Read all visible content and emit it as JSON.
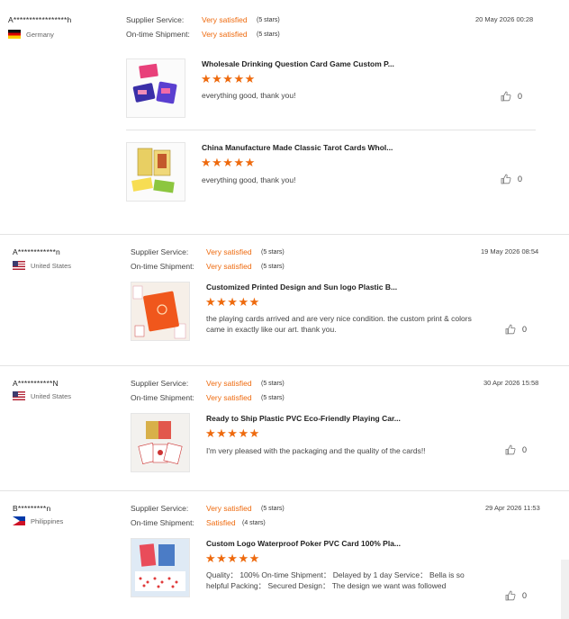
{
  "reviews": [
    {
      "buyer": "A*****************h",
      "country": "Germany",
      "flag": "de",
      "supplier_service_label": "Supplier Service:",
      "supplier_service_value": "Very satisfied",
      "supplier_service_stars": "(5 stars)",
      "shipment_label": "On-time Shipment:",
      "shipment_value": "Very satisfied",
      "shipment_stars": "(5 stars)",
      "date": "20 May 2026 00:28",
      "products": [
        {
          "title": "Wholesale Drinking Question Card Game Custom P...",
          "rating": "★★★★★",
          "comment": "everything good, thank you!",
          "likes": "0"
        },
        {
          "title": "China Manufacture Made Classic Tarot Cards Whol...",
          "rating": "★★★★★",
          "comment": "everything good, thank you!",
          "likes": "0"
        }
      ]
    },
    {
      "buyer": "A************n",
      "country": "United States",
      "flag": "us",
      "supplier_service_label": "Supplier Service:",
      "supplier_service_value": "Very satisfied",
      "supplier_service_stars": "(5 stars)",
      "shipment_label": "On-time Shipment:",
      "shipment_value": "Very satisfied",
      "shipment_stars": "(5 stars)",
      "date": "19 May 2026 08:54",
      "products": [
        {
          "title": "Customized Printed Design and Sun logo Plastic B...",
          "rating": "★★★★★",
          "comment": "the playing cards arrived and are very nice condition. the custom print & colors came in exactly like our art. thank you.",
          "likes": "0"
        }
      ]
    },
    {
      "buyer": "A***********N",
      "country": "United States",
      "flag": "us",
      "supplier_service_label": "Supplier Service:",
      "supplier_service_value": "Very satisfied",
      "supplier_service_stars": "(5 stars)",
      "shipment_label": "On-time Shipment:",
      "shipment_value": "Very satisfied",
      "shipment_stars": "(5 stars)",
      "date": "30 Apr 2026 15:58",
      "products": [
        {
          "title": "Ready to Ship Plastic PVC Eco-Friendly Playing Car...",
          "rating": "★★★★★",
          "comment": "I'm very pleased with the packaging and the quality of the cards!!",
          "likes": "0"
        }
      ]
    },
    {
      "buyer": "B*********n",
      "country": "Philippines",
      "flag": "ph",
      "supplier_service_label": "Supplier Service:",
      "supplier_service_value": "Very satisfied",
      "supplier_service_stars": "(5 stars)",
      "shipment_label": "On-time Shipment:",
      "shipment_value": "Satisfied",
      "shipment_stars": "(4 stars)",
      "date": "29 Apr 2026 11:53",
      "products": [
        {
          "title": "Custom Logo Waterproof Poker PVC Card 100% Pla...",
          "rating": "★★★★★",
          "comment": "Quality： 100% On-time Shipment： Delayed by 1 day Service： Bella is so helpful Packing： Secured Design： The design we want was followed",
          "likes": "0"
        }
      ]
    }
  ],
  "colors": {
    "accent": "#ee6a0e",
    "divider": "#e3e3e3"
  },
  "icons": {
    "like": "thumbs-up-icon"
  }
}
